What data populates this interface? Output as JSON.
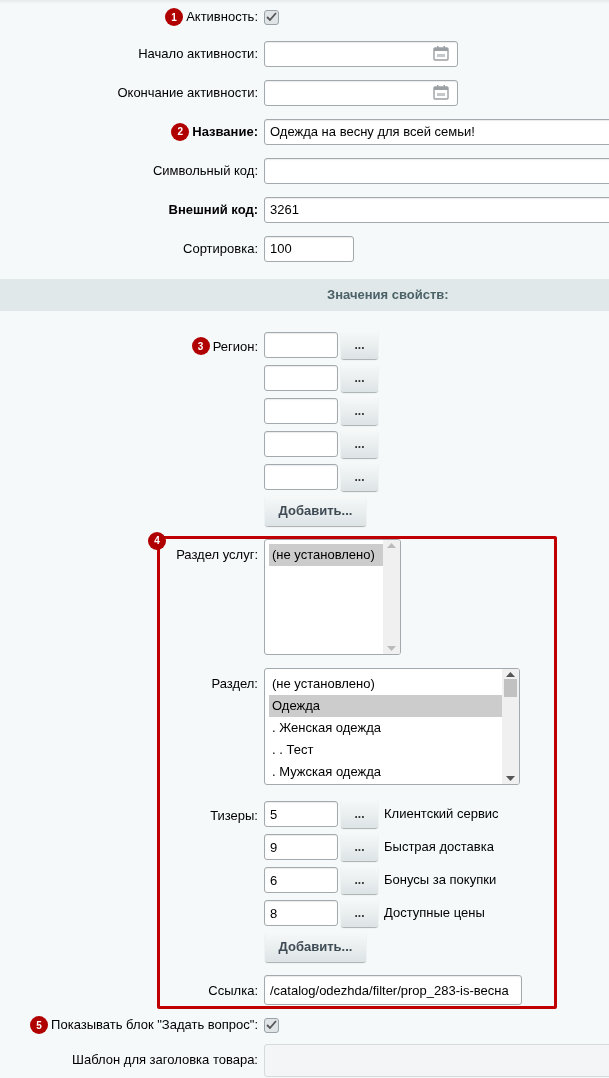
{
  "fields": [
    {
      "kind": "checkbox",
      "label": "Активность:",
      "badge": "1",
      "checked": true
    },
    {
      "kind": "date",
      "label": "Начало активности:"
    },
    {
      "kind": "date",
      "label": "Окончание активности:"
    },
    {
      "kind": "wide",
      "label": "Название:",
      "bold": true,
      "badge": "2",
      "value": "Одежда на весну для всей семьи!"
    },
    {
      "kind": "wide",
      "label": "Символьный код:"
    },
    {
      "kind": "wide",
      "label": "Внешний код:",
      "bold": true,
      "value": "3261"
    },
    {
      "kind": "short",
      "label": "Сортировка:",
      "value": "100"
    }
  ],
  "section": {
    "title": "Значения свойств:"
  },
  "region": {
    "label": "Регион:",
    "badge": "3",
    "rows": [
      {
        "button": "..."
      },
      {
        "button": "..."
      },
      {
        "button": "..."
      },
      {
        "button": "..."
      },
      {
        "button": "..."
      }
    ],
    "add": "Добавить..."
  },
  "highlight": {
    "badge": "4",
    "service_section": {
      "label": "Раздел услуг:",
      "options": [
        {
          "text": "(не установлено)",
          "selected": true
        }
      ]
    },
    "section": {
      "label": "Раздел:",
      "options": [
        {
          "text": "(не установлено)",
          "selected": false
        },
        {
          "text": "Одежда",
          "selected": true
        },
        {
          "text": ". Женская одежда",
          "selected": false
        },
        {
          "text": ". . Тест",
          "selected": false
        },
        {
          "text": ". Мужская одежда",
          "selected": false
        }
      ]
    },
    "teasers": {
      "label": "Тизеры:",
      "rows": [
        {
          "value": "5",
          "button": "...",
          "caption": "Клиентский сервис"
        },
        {
          "value": "9",
          "button": "...",
          "caption": "Быстрая доставка"
        },
        {
          "value": "6",
          "button": "...",
          "caption": "Бонусы за покупки"
        },
        {
          "value": "8",
          "button": "...",
          "caption": "Доступные цены"
        }
      ],
      "add": "Добавить..."
    },
    "link": {
      "label": "Ссылка:",
      "value": "/catalog/odezhda/filter/prop_283-is-весна"
    }
  },
  "show_question": {
    "badge": "5",
    "label": "Показывать блок \"Задать вопрос\":",
    "checked": true
  },
  "title_template": {
    "label": "Шаблон для заголовка товара:",
    "disabled": true
  }
}
